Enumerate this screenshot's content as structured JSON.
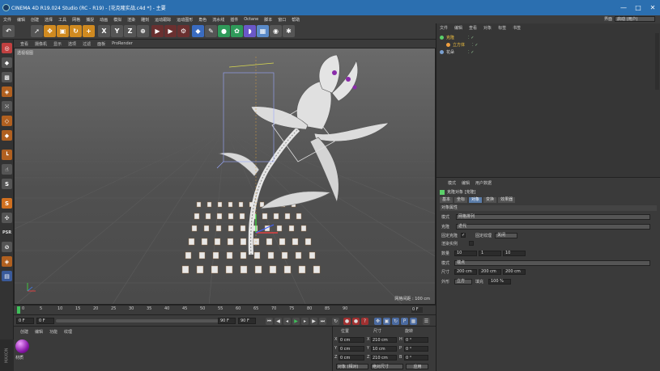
{
  "window": {
    "title": "CINEMA 4D R19.024 Studio (RC - R19) - [花克隆实战.c4d *] - 主要",
    "controls": [
      "—",
      "□",
      "✕"
    ]
  },
  "menubar": {
    "items": [
      "文件",
      "编辑",
      "创建",
      "选择",
      "工具",
      "网格",
      "捕捉",
      "动画",
      "模拟",
      "渲染",
      "雕刻",
      "运动跟踪",
      "运动图形",
      "角色",
      "流水线",
      "插件",
      "Octane",
      "脚本",
      "窗口",
      "帮助"
    ],
    "layout_label": "界面",
    "layout_value": "启动 (用户)"
  },
  "viewport": {
    "menu": [
      "查看",
      "摄像机",
      "显示",
      "选项",
      "过滤",
      "面板",
      "ProRender"
    ],
    "label": "透视视图",
    "grid_info": "网格间距 : 100 cm"
  },
  "timeline": {
    "ticks": [
      "0",
      "5",
      "10",
      "15",
      "20",
      "25",
      "30",
      "35",
      "40",
      "45",
      "50",
      "55",
      "60",
      "65",
      "70",
      "75",
      "80",
      "85",
      "90"
    ],
    "frame_end": "0 F"
  },
  "transport": {
    "current_frame": "0 F",
    "start_frame": "0 F",
    "end_frame": "90 F",
    "end_frame2": "90 F"
  },
  "material_manager": {
    "menu": [
      "创建",
      "编辑",
      "功能",
      "纹理"
    ],
    "material_name": "材质"
  },
  "coordinates": {
    "headers": [
      "位置",
      "尺寸",
      "旋转"
    ],
    "rows": [
      {
        "axis": "X",
        "pos": "0 cm",
        "size_axis": "X",
        "size": "210 cm",
        "rot_axis": "H",
        "rot": "0 °"
      },
      {
        "axis": "Y",
        "pos": "0 cm",
        "size_axis": "Y",
        "size": "10 cm",
        "rot_axis": "P",
        "rot": "0 °"
      },
      {
        "axis": "Z",
        "pos": "0 cm",
        "size_axis": "Z",
        "size": "210 cm",
        "rot_axis": "B",
        "rot": "0 °"
      }
    ],
    "mode": "对象 (相对)",
    "size_mode": "绝对尺寸",
    "apply": "应用"
  },
  "object_manager": {
    "tabs": [
      "文件",
      "编辑",
      "查看",
      "对象",
      "标签",
      "书签"
    ],
    "objects": [
      {
        "name": "克隆",
        "color": "#5bd06a"
      },
      {
        "name": "立方体",
        "color": "#f0a040"
      },
      {
        "name": "花朵",
        "color": "#7aa0d0"
      }
    ]
  },
  "attributes": {
    "menu": [
      "模式",
      "编辑",
      "用户数据"
    ],
    "object_title": "克隆对象 [克隆]",
    "tabs": [
      "基本",
      "坐标",
      "对象",
      "变换",
      "效果器"
    ],
    "active_tab": 2,
    "section": "对象属性",
    "mode_label": "模式",
    "mode_value": "网格排列",
    "clones_label": "克隆",
    "clones_value": "迭代",
    "fix_clone_label": "固定克隆",
    "fix_texture_label": "固定纹理",
    "fix_texture_value": "关闭",
    "render_instances_label": "渲染实例",
    "count_label": "数量",
    "count_values": [
      "10",
      "1",
      "10"
    ],
    "mode2_label": "模式",
    "mode2_value": "端点",
    "size_label": "尺寸",
    "size_values": [
      "200 cm",
      "200 cm",
      "200 cm"
    ],
    "shape_label": "外形",
    "shape_value": "立方",
    "fill_label": "填充",
    "fill_value": "100 %"
  }
}
